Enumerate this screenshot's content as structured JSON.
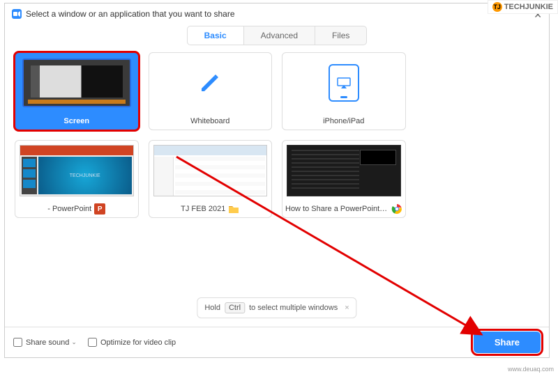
{
  "watermark": {
    "brand": "TECHJUNKIE",
    "brand_initials": "TJ",
    "url": "www.deuaq.com"
  },
  "dialog": {
    "title": "Select a window or an application that you want to share"
  },
  "tabs": {
    "basic": "Basic",
    "advanced": "Advanced",
    "files": "Files",
    "active": "basic"
  },
  "tiles": {
    "screen": {
      "label": "Screen"
    },
    "whiteboard": {
      "label": "Whiteboard"
    },
    "iphone": {
      "label": "iPhone/iPad"
    },
    "powerpoint": {
      "label": "- PowerPoint",
      "app_initial": "P"
    },
    "explorer": {
      "label": "TJ FEB 2021"
    },
    "chrome": {
      "label": "How to Share a PowerPoint Prese..."
    }
  },
  "hint": {
    "prefix": "Hold",
    "key": "Ctrl",
    "suffix": "to select multiple windows"
  },
  "footer": {
    "share_sound": "Share sound",
    "optimize": "Optimize for video clip",
    "share_button": "Share"
  }
}
